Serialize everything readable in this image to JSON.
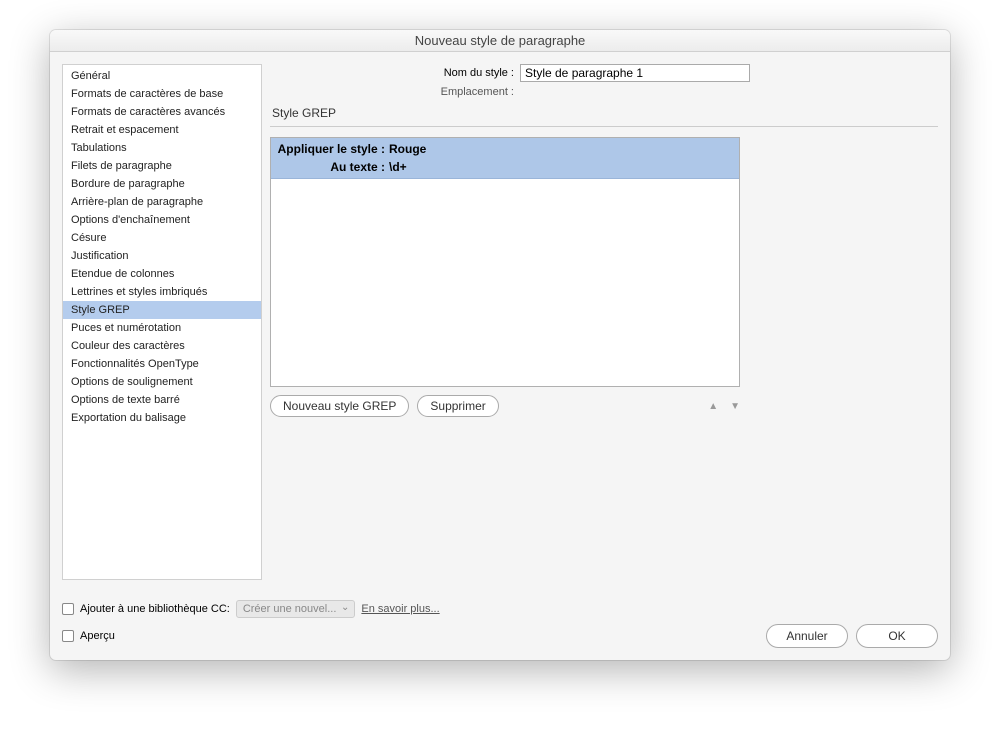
{
  "dialog": {
    "title": "Nouveau style de paragraphe"
  },
  "sidebar": {
    "items": [
      "Général",
      "Formats de caractères de base",
      "Formats de caractères avancés",
      "Retrait et espacement",
      "Tabulations",
      "Filets de paragraphe",
      "Bordure de paragraphe",
      "Arrière-plan de paragraphe",
      "Options d'enchaînement",
      "Césure",
      "Justification",
      "Etendue de colonnes",
      "Lettrines et styles imbriqués",
      "Style GREP",
      "Puces et numérotation",
      "Couleur des caractères",
      "Fonctionnalités OpenType",
      "Options de soulignement",
      "Options de texte barré",
      "Exportation du balisage"
    ],
    "selected_index": 13
  },
  "header": {
    "name_label": "Nom du style :",
    "name_value": "Style de paragraphe 1",
    "location_label": "Emplacement :"
  },
  "panel": {
    "title": "Style GREP",
    "apply_label": "Appliquer le style :",
    "apply_value": "Rouge",
    "text_label": "Au texte :",
    "text_value": "\\d+",
    "new_button": "Nouveau style GREP",
    "delete_button": "Supprimer"
  },
  "footer": {
    "library_label": "Ajouter à une bibliothèque CC:",
    "library_select": "Créer une nouvel...",
    "learn_more": "En savoir plus...",
    "preview_label": "Aperçu",
    "cancel": "Annuler",
    "ok": "OK"
  }
}
